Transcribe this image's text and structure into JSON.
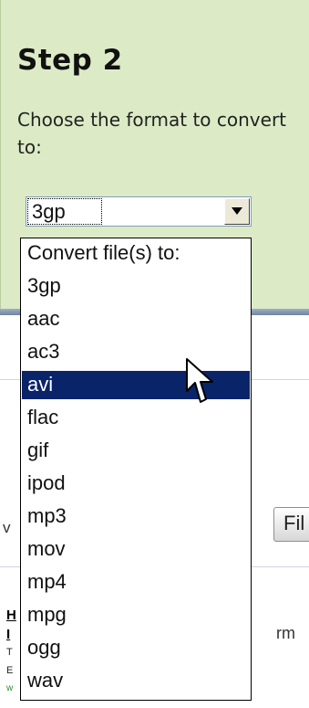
{
  "step": {
    "title": "Step 2",
    "instruction": "Choose the format to convert to:"
  },
  "format_select": {
    "selected_value": "3gp",
    "options": [
      "Convert file(s) to:",
      "3gp",
      "aac",
      "ac3",
      "avi",
      "flac",
      "gif",
      "ipod",
      "mp3",
      "mov",
      "mp4",
      "mpg",
      "ogg",
      "wav"
    ],
    "highlighted_option": "avi"
  },
  "background": {
    "left_v": "v",
    "button_fragment": "Fil",
    "heading_fragment_h": "H",
    "heading_fragment_i": "I",
    "text_t": "T",
    "text_e": "E",
    "text_w": "w",
    "text_rm": "rm"
  },
  "colors": {
    "panel": "#dcebc6",
    "highlight": "#0a246a",
    "rule": "#6f849f"
  }
}
